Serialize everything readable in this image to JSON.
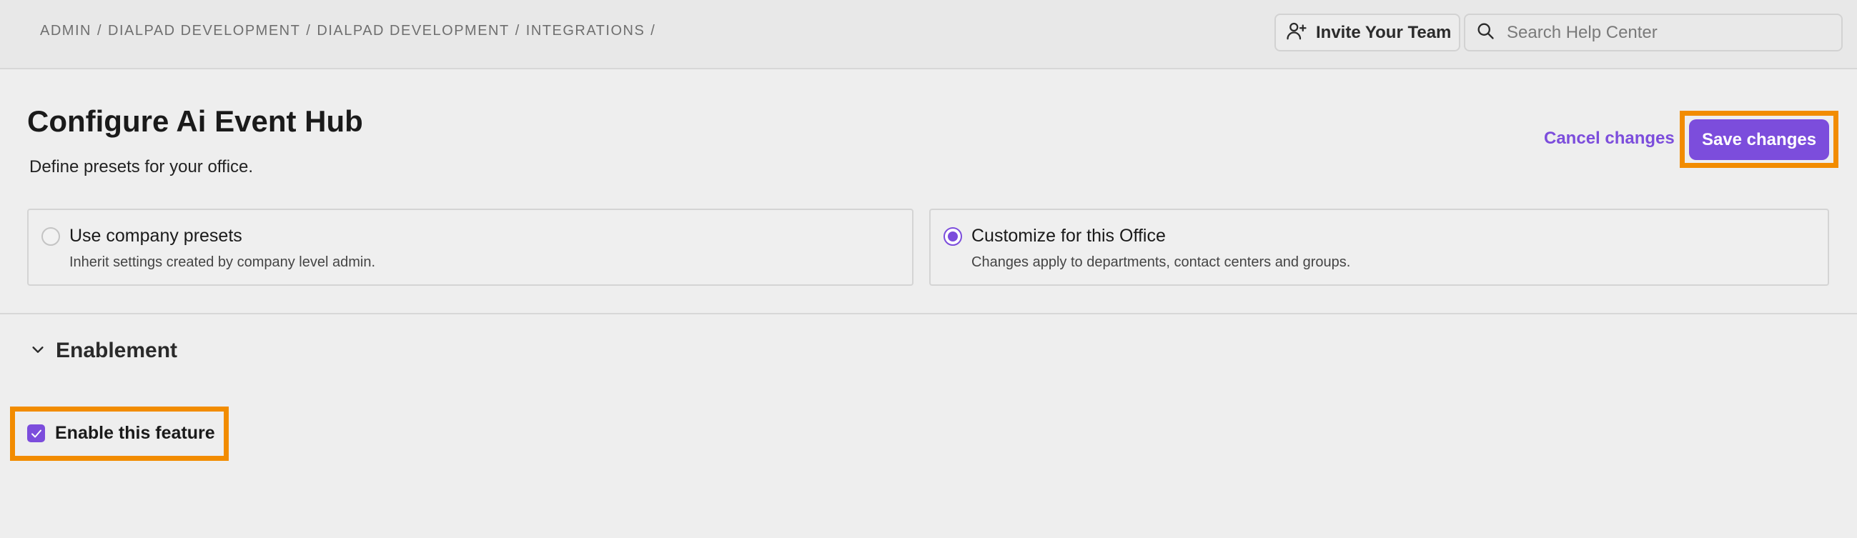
{
  "breadcrumb": {
    "items": [
      "ADMIN",
      "DIALPAD DEVELOPMENT",
      "DIALPAD DEVELOPMENT",
      "INTEGRATIONS"
    ],
    "separator": "/"
  },
  "header": {
    "invite_label": "Invite Your Team",
    "search_placeholder": "Search Help Center",
    "search_value": ""
  },
  "page": {
    "title": "Configure Ai Event Hub",
    "subtitle": "Define presets for your office.",
    "cancel_label": "Cancel changes",
    "save_label": "Save changes"
  },
  "options": [
    {
      "title": "Use company presets",
      "description": "Inherit settings created by company level admin.",
      "selected": false
    },
    {
      "title": "Customize for this Office",
      "description": "Changes apply to departments, contact centers and groups.",
      "selected": true
    }
  ],
  "section": {
    "title": "Enablement",
    "expanded": true,
    "feature_label": "Enable this feature",
    "feature_checked": true
  },
  "colors": {
    "accent": "#7c4ddc",
    "highlight": "#f28c00",
    "background": "#eeeeee",
    "topbar": "#e8e8e8"
  },
  "icons": {
    "invite": "user-plus-icon",
    "search": "search-icon",
    "chevron": "chevron-down-icon",
    "check": "check-icon"
  }
}
